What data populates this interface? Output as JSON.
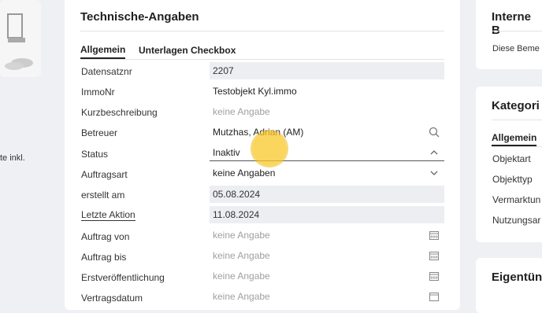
{
  "left_panel": {
    "text": "te inkl."
  },
  "main": {
    "title": "Technische-Angaben",
    "tabs": [
      {
        "label": "Allgemein",
        "active": true
      },
      {
        "label": "Unterlagen Checkbox",
        "active": false
      }
    ],
    "fields": [
      {
        "label": "Datensatznr",
        "value": "2207"
      },
      {
        "label": "ImmoNr",
        "value": "Testobjekt Kyl.immo"
      },
      {
        "label": "Kurzbeschreibung",
        "placeholder": "keine Angabe"
      },
      {
        "label": "Betreuer",
        "value": "Mutzhas, Adrian (AM)",
        "icon": "search-icon"
      },
      {
        "label": "Status",
        "value": "Inaktiv",
        "icon": "chevron-up-icon"
      },
      {
        "label": "Auftragsart",
        "value": "keine Angaben",
        "icon": "chevron-down-icon"
      },
      {
        "label": "erstellt am",
        "value": "05.08.2024"
      },
      {
        "label": "Letzte Aktion",
        "value": "11.08.2024"
      },
      {
        "label": "Auftrag von",
        "placeholder": "keine Angabe",
        "icon": "calendar-icon"
      },
      {
        "label": "Auftrag bis",
        "placeholder": "keine Angabe",
        "icon": "calendar-icon"
      },
      {
        "label": "Erstveröffentlichung",
        "placeholder": "keine Angabe",
        "icon": "calendar-icon"
      },
      {
        "label": "Vertragsdatum",
        "placeholder": "keine Angabe",
        "icon": "calendar-icon"
      }
    ]
  },
  "right": {
    "interne_title": "Interne B",
    "interne_text": "Diese Beme",
    "kategorie_title": "Kategori",
    "kategorie_tab": "Allgemein",
    "kategorie_items": [
      "Objektart",
      "Objekttyp",
      "Vermarktun",
      "Nutzungsar"
    ],
    "eigentuemer_title": "Eigentün"
  },
  "colors": {
    "readonly_bg": "#eceef1",
    "page_bg": "#eef0f3",
    "cursor": "#f7c52b"
  }
}
